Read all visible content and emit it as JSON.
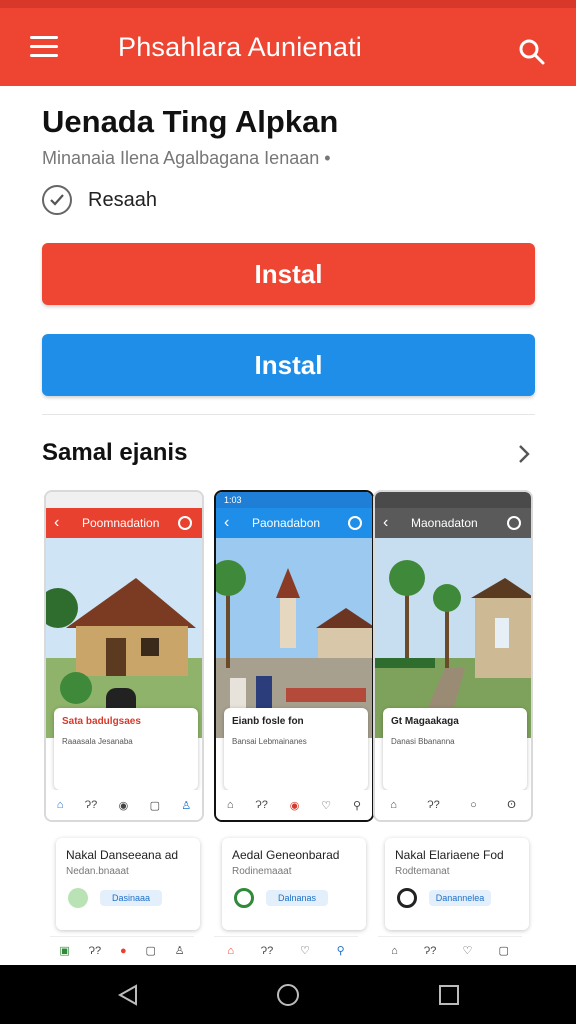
{
  "colors": {
    "accent_red": "#ee4432",
    "accent_blue": "#1f8ee8",
    "system_nav": "#000000"
  },
  "app_bar": {
    "title": "Phsahlara Aunienati",
    "menu_icon": "menu-icon",
    "search_icon": "search-icon"
  },
  "app": {
    "name": "Uenada Ting Alpkan",
    "subtitle": "Minanaia Ilena Agalbagana Ienaan •",
    "verified_label": "Resaah",
    "install_primary_label": "Instal",
    "install_secondary_label": "Instal"
  },
  "screenshots_section": {
    "title": "Samal ejanis",
    "shots": [
      {
        "status": "",
        "title": "Poomnadation",
        "card_title": "Sata badulgsaes",
        "card_line": "Raaasala  Jesanaba",
        "nav": [
          "⌂",
          "Ɂ?",
          "◉",
          "▢",
          "♙"
        ]
      },
      {
        "status": "1:03",
        "title": "Paonadabon",
        "card_title": "Eianb fosle fon",
        "card_line": "Bansai Lebmainanes",
        "nav": [
          "⌂",
          "Ɂ?",
          "◉",
          "♡",
          "⚲"
        ]
      },
      {
        "status": "",
        "title": "Maonadaton",
        "card_title": "Gt Magaakaga",
        "card_line": "Danasi  Bbananna",
        "nav": [
          "⌂",
          "Ɂ?",
          "○",
          "ʘ",
          ""
        ]
      }
    ]
  },
  "feature_cards": [
    {
      "title": "Nakal Danseeana ad",
      "sub": "Nedan.bnaaat",
      "pill": "Dasinaaa"
    },
    {
      "title": "Aedal Geneonbarad",
      "sub": "Rodinemaaat",
      "pill": "Dalnanas"
    },
    {
      "title": "Nakal Elariaene Fod",
      "sub": "Rodtemanat",
      "pill": "Danannelea"
    }
  ],
  "mini_navs": [
    [
      "▣",
      "Ɂ?",
      "●",
      "▢",
      "♙"
    ],
    [
      "⌂",
      "Ɂ?",
      "♡",
      "⚲"
    ],
    [
      "⌂",
      "Ɂ?",
      "♡",
      "▢"
    ]
  ],
  "system_nav": {
    "back": "back-icon",
    "home": "home-icon",
    "recents": "recents-icon"
  }
}
